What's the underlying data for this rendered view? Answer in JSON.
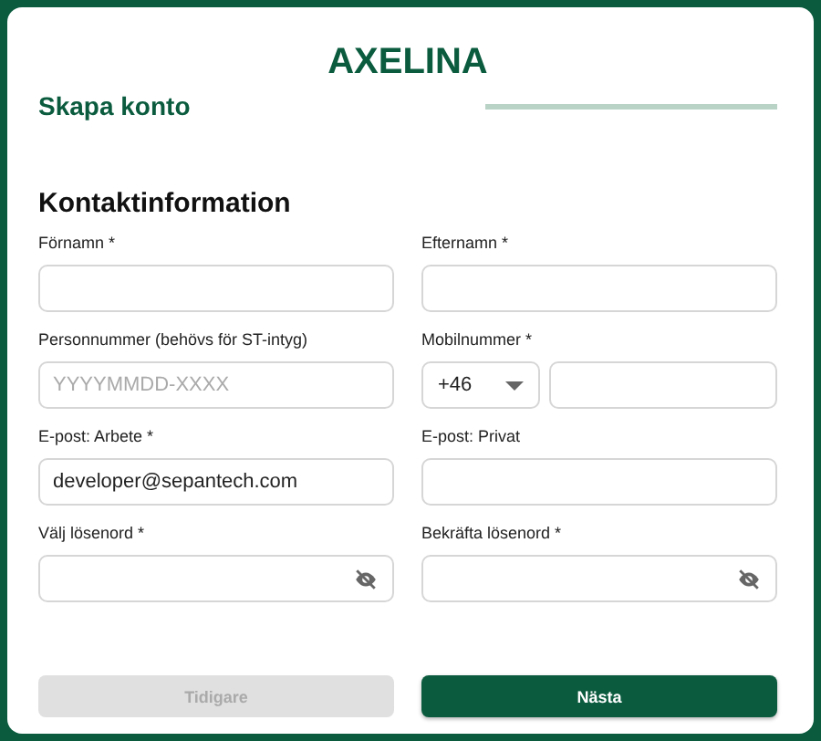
{
  "brand": "AXELINA",
  "page_title": "Skapa konto",
  "section_title": "Kontaktinformation",
  "fields": [
    {
      "kind": "text",
      "label": "Förnamn *"
    },
    {
      "kind": "text",
      "label": "Efternamn *"
    },
    {
      "kind": "text",
      "label": "Personnummer (behövs för ST-intyg)",
      "placeholder": "YYYYMMDD-XXXX"
    },
    {
      "kind": "phone",
      "label": "Mobilnummer *",
      "country_code": "+46"
    },
    {
      "kind": "text",
      "label": "E-post: Arbete *",
      "value": "developer@sepantech.com"
    },
    {
      "kind": "text",
      "label": "E-post: Privat"
    },
    {
      "kind": "password",
      "label": "Välj lösenord *"
    },
    {
      "kind": "password",
      "label": "Bekräfta lösenord *"
    }
  ],
  "buttons": [
    {
      "label": "Tidigare",
      "disabled": true
    },
    {
      "label": "Nästa",
      "disabled": false
    }
  ]
}
